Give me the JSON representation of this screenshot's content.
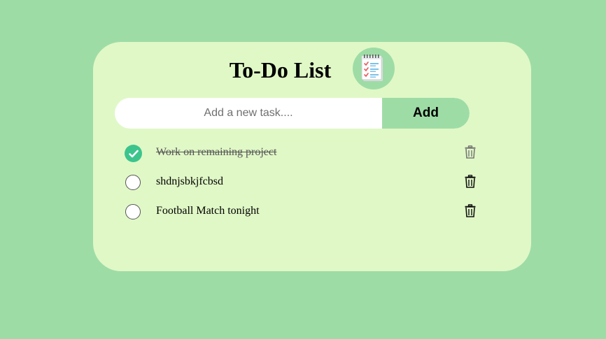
{
  "app": {
    "title": "To-Do List",
    "logo_icon": "notepad-checklist-icon"
  },
  "input": {
    "placeholder": "Add a new task....",
    "value": "",
    "add_label": "Add"
  },
  "tasks": [
    {
      "text": "Work on remaining project",
      "completed": true
    },
    {
      "text": "shdnjsbkjfcbsd",
      "completed": false
    },
    {
      "text": "Football Match tonight",
      "completed": false
    }
  ],
  "colors": {
    "background": "#9edca6",
    "card": "#e0f8c6",
    "accent": "#9edca6",
    "check": "#3cc48d"
  }
}
